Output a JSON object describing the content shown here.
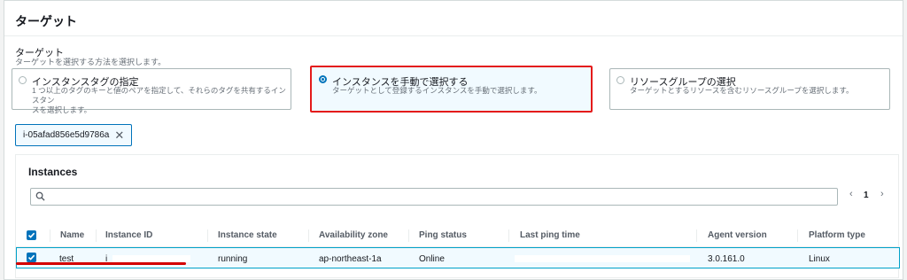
{
  "panel": {
    "title": "ターゲット"
  },
  "target_field": {
    "label": "ターゲット",
    "description": "ターゲットを選択する方法を選択します。"
  },
  "options": [
    {
      "title": "インスタンスタグの指定",
      "description_line1": "1 つ以上のタグのキーと値のペアを指定して、それらのタグを共有するインスタン",
      "description_line2": "スを選択します。",
      "selected": false
    },
    {
      "title": "インスタンスを手動で選択する",
      "description_line1": "ターゲットとして登録するインスタンスを手動で選択します。",
      "selected": true
    },
    {
      "title": "リソースグループの選択",
      "description_line1": "ターゲットとするリソースを含むリソースグループを選択します。",
      "selected": false
    }
  ],
  "token": {
    "label": "i-05afad856e5d9786a",
    "remove_icon": "close-icon"
  },
  "instances": {
    "title": "Instances",
    "search_placeholder": "",
    "pagination": {
      "prev_icon": "chevron-left-icon",
      "page": "1",
      "next_icon": "chevron-right-icon"
    },
    "columns": [
      "Name",
      "Instance ID",
      "Instance state",
      "Availability zone",
      "Ping status",
      "Last ping time",
      "Agent version",
      "Platform type"
    ],
    "rows": [
      {
        "name": "test",
        "instance_id": "i",
        "state": "running",
        "az": "ap-northeast-1a",
        "ping": "Online",
        "last_ping": "",
        "agent": "3.0.161.0",
        "platform": "Linux",
        "checked": true
      }
    ]
  },
  "colors": {
    "accent": "#0073bb",
    "highlight": "#e41b1b",
    "selected_bg": "#f1faff"
  }
}
